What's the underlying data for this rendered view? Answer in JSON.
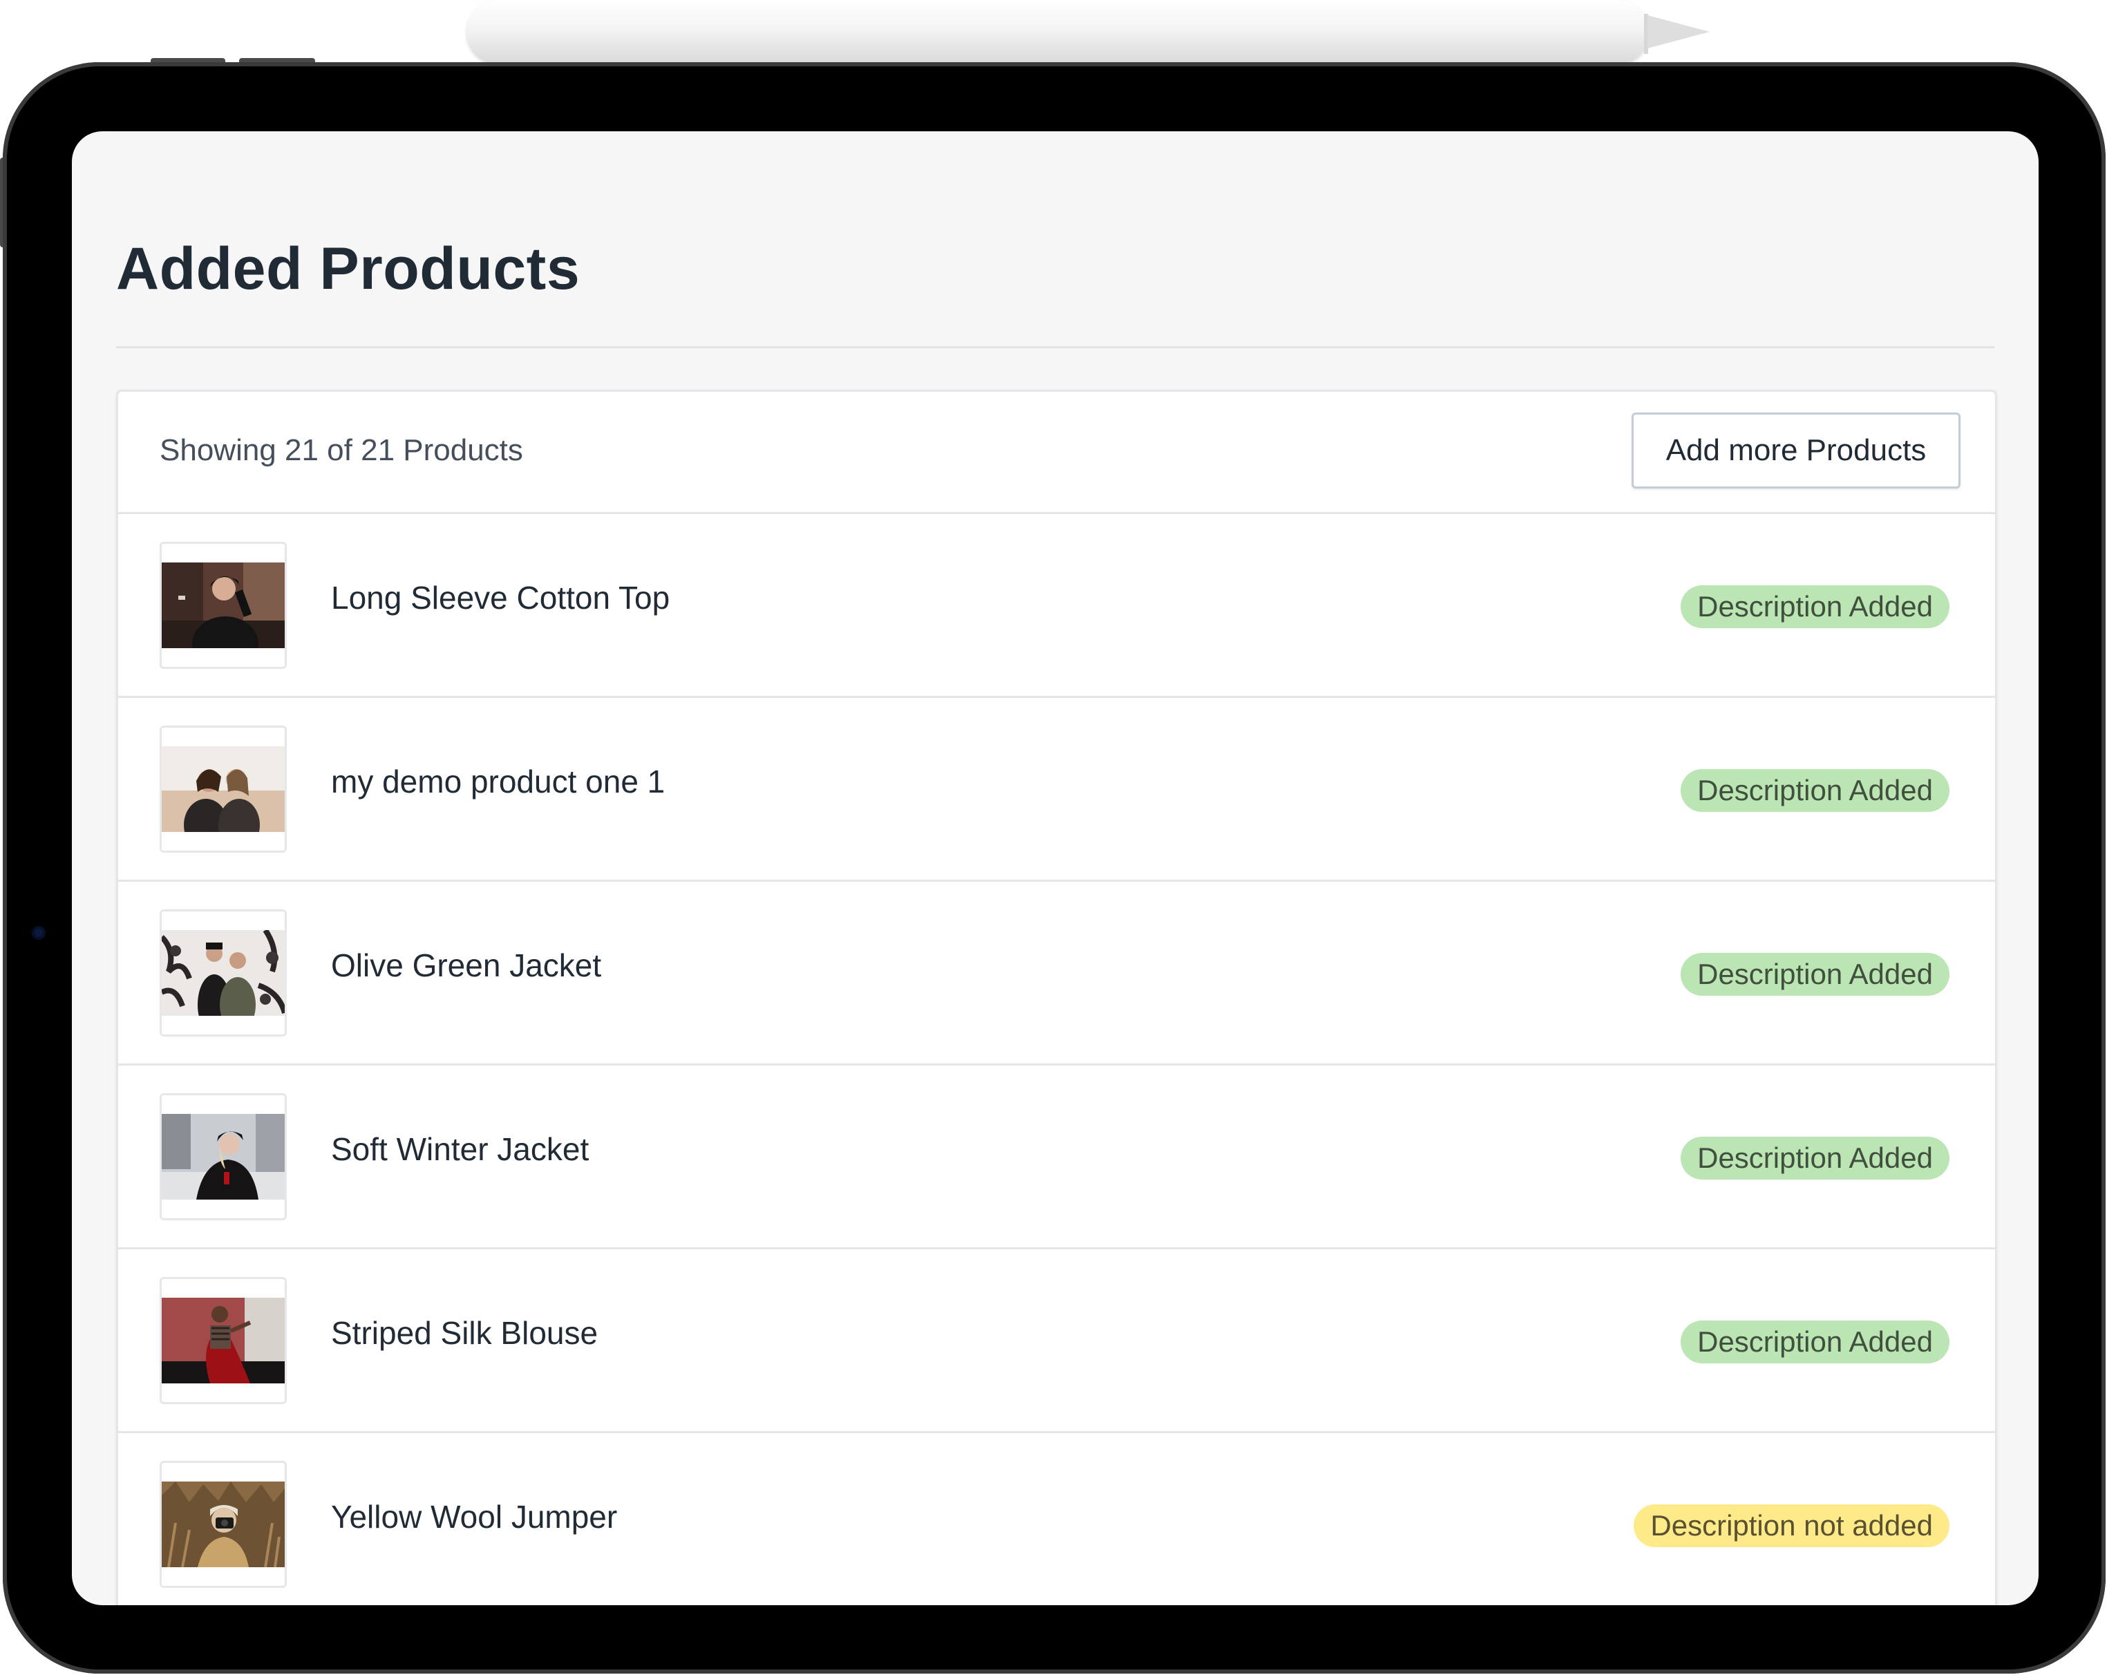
{
  "page": {
    "title": "Added Products"
  },
  "list": {
    "result_count": "Showing 21 of 21 Products",
    "add_button_label": "Add more Products"
  },
  "status_colors": {
    "added_bg": "#bbe5b3",
    "added_text": "#414f3e",
    "missing_bg": "#ffea8a",
    "missing_text": "#595130"
  },
  "products": [
    {
      "title": "Long Sleeve Cotton Top",
      "status": "Description Added",
      "status_type": "added",
      "thumbnail": "woman-dark-top-photo"
    },
    {
      "title": "my demo product one 1",
      "status": "Description Added",
      "status_type": "added",
      "thumbnail": "two-women-beach-photo"
    },
    {
      "title": "Olive Green Jacket",
      "status": "Description Added",
      "status_type": "added",
      "thumbnail": "couple-patterned-wall-photo"
    },
    {
      "title": "Soft Winter Jacket",
      "status": "Description Added",
      "status_type": "added",
      "thumbnail": "woman-winter-street-photo"
    },
    {
      "title": "Striped Silk Blouse",
      "status": "Description Added",
      "status_type": "added",
      "thumbnail": "woman-red-dress-photo"
    },
    {
      "title": "Yellow Wool Jumper",
      "status": "Description not added",
      "status_type": "missing",
      "thumbnail": "woman-camera-field-photo"
    }
  ]
}
